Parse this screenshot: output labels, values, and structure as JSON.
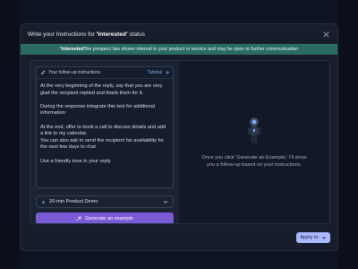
{
  "modal": {
    "title_prefix": "Write your Instructions for ",
    "title_status": "'Interested'",
    "title_suffix": " status"
  },
  "banner": {
    "label": "'Interested'",
    "text": " the prospect has shown interest in your product or service and may be open to further communication"
  },
  "instructions": {
    "heading": "Your follow-up instructions",
    "tutorial_label": "Tutorial",
    "paragraphs": [
      "At the very beginning of the reply, say that you are very glad the recipient replied and thank them for it.",
      "During the response integrate this text for additional information:",
      "At the end, offer to book a call to discuss details and add a link to my calendar.\nYou can also ask to send the recipient his availability for the next few days to chat",
      "Use a friendly tone in your reply"
    ]
  },
  "select": {
    "value": "20-min Product Demo"
  },
  "generate_button": {
    "label": "Generate an example"
  },
  "preview": {
    "hint": "Once you click 'Generate an Example,' I'll show you a follow-up based on your instructions."
  },
  "footer": {
    "apply_label": "Apply to"
  },
  "colors": {
    "accent": "#7b5ad6",
    "banner": "#2b6b63",
    "link": "#7fb1ff",
    "apply": "#a9b8ff"
  }
}
